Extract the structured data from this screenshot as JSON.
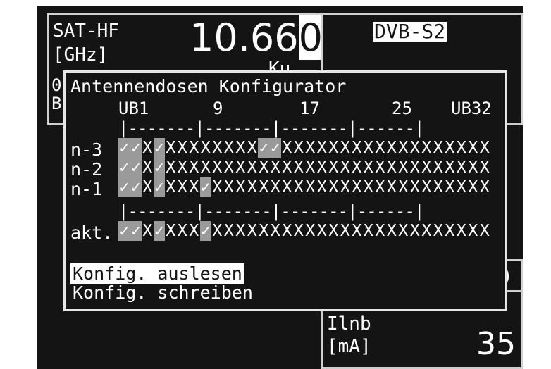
{
  "top_left": {
    "label1": "SAT-HF",
    "label2": "[GHz]",
    "freq_main": "10.66",
    "freq_cursor": "0",
    "band_partial": "Ku",
    "hidden_left1": "0",
    "hidden_left2": "B"
  },
  "top_right": {
    "mode": "DVB-S2"
  },
  "right_edge_partial": "0",
  "bottom_right": {
    "label1": "Ilnb",
    "label2": "[mA]",
    "value": "35"
  },
  "dialog": {
    "title": "Antennendosen Konfigurator",
    "header": {
      "ub1": "UB1",
      "c9": "9",
      "c17": "17",
      "c25": "25",
      "ub32": "UB32"
    },
    "separator": "|-------|-------|-------|------|",
    "rows": [
      {
        "label": "n-3",
        "cells": "✓✓X✓XXXXXXXX✓✓XXXXXXXXXXXXXXXXXX",
        "hl": [
          0,
          1,
          3,
          12,
          13
        ]
      },
      {
        "label": "n-2",
        "cells": "✓✓X✓XXXXXXXXXXXXXXXXXXXXXXXXXXXX",
        "hl": [
          0,
          1,
          3
        ]
      },
      {
        "label": "n-1",
        "cells": "✓✓X✓XXX✓XXXXXXXXXXXXXXXXXXXXXXXX",
        "hl": [
          0,
          1,
          3,
          7
        ]
      }
    ],
    "akt": {
      "label": "akt.",
      "cells": "✓✓X✓XXX✓XXXXXXXXXXXXXXXXXXXXXXXX",
      "hl": [
        0,
        1,
        3,
        7
      ]
    },
    "menu": [
      {
        "label": "Konfig. auslesen",
        "selected": true
      },
      {
        "label": "Konfig. schreiben",
        "selected": false
      }
    ]
  },
  "colors": {
    "background": "#141414",
    "text": "#ffffff",
    "highlight": "#9a9a9a",
    "border": "#e6e6e6"
  }
}
